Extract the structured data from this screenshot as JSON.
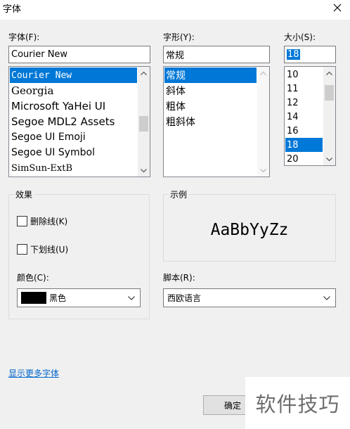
{
  "window": {
    "title": "字体"
  },
  "font": {
    "label": "字体(F):",
    "value": "Courier New",
    "items": [
      "Courier New",
      "Georgia",
      "Microsoft YaHei UI",
      "Segoe MDL2 Assets",
      "Segoe UI Emoji",
      "Segoe UI Symbol",
      "SimSun-ExtB"
    ]
  },
  "style": {
    "label": "字形(Y):",
    "value": "常规",
    "items": [
      "常规",
      "斜体",
      "粗体",
      "粗斜体"
    ]
  },
  "size": {
    "label": "大小(S):",
    "value": "18",
    "items": [
      "10",
      "11",
      "12",
      "14",
      "16",
      "18",
      "20"
    ]
  },
  "effects": {
    "title": "效果",
    "strikeout": "删除线(K)",
    "underline": "下划线(U)",
    "color_label": "颜色(C):",
    "color_value": "黑色",
    "color_swatch": "#000000"
  },
  "sample": {
    "title": "示例",
    "text": "AaBbYyZz"
  },
  "script": {
    "label": "脚本(R):",
    "value": "西欧语言"
  },
  "more_fonts": "显示更多字体",
  "ok_button": "确定",
  "watermark": "软件技巧",
  "colors": {
    "selection": "#0078d7",
    "link": "#0066cc"
  }
}
